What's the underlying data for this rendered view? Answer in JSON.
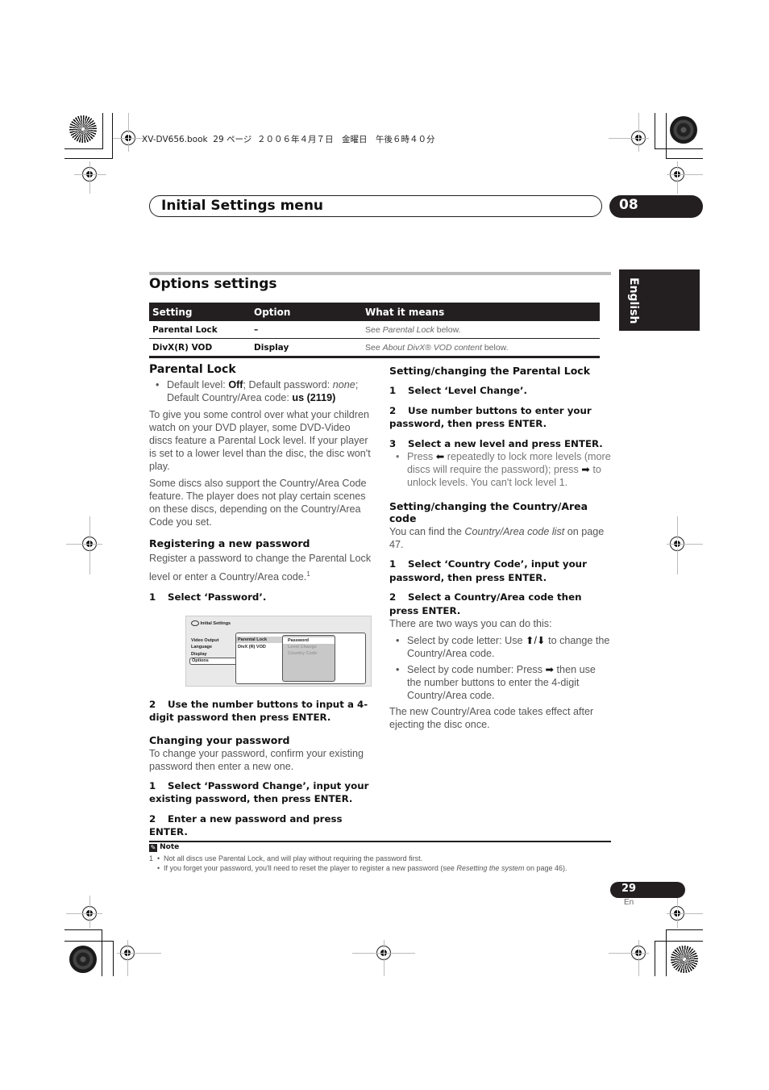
{
  "print_header": "XV-DV656.book  29 ページ  ２００６年４月７日　金曜日　午後６時４０分",
  "chapter": {
    "title": "Initial Settings menu",
    "number": "08"
  },
  "language_tab": "English",
  "section_title": "Options settings",
  "table": {
    "headers": [
      "Setting",
      "Option",
      "What it means"
    ],
    "rows": [
      {
        "setting": "Parental Lock",
        "option": "–",
        "meaning_prefix": "See ",
        "meaning_italic": "Parental Lock",
        "meaning_suffix": " below."
      },
      {
        "setting": "DivX(R) VOD",
        "option": "Display",
        "meaning_prefix": "See ",
        "meaning_italic": "About DivX® VOD content",
        "meaning_suffix": " below."
      }
    ]
  },
  "left": {
    "parental_lock": {
      "title": "Parental Lock",
      "defaults": {
        "level_label": "Default level: ",
        "level_value": "Off",
        "password_label": "; Default password: ",
        "password_value": "none",
        "country_label": "; Default Country/Area code: ",
        "country_value": "us (2119)"
      },
      "para1": "To give you some control over what your children watch on your DVD player, some DVD-Video discs feature a Parental Lock level. If your player is set to a lower level than the disc, the disc won't play.",
      "para2": "Some discs also support the Country/Area Code feature. The player does not play certain scenes on these discs, depending on the Country/Area Code you set."
    },
    "register": {
      "title": "Registering a new password",
      "text": "Register a password to change the Parental Lock level or enter a Country/Area code.",
      "footnote_ref": "1",
      "step1_num": "1",
      "step1": "Select ‘Password’.",
      "step2_num": "2",
      "step2": "Use the number buttons to input a 4-digit password then press ENTER."
    },
    "osd": {
      "title": "Initial Settings",
      "menu": [
        "Video Output",
        "Language",
        "Display",
        "Options"
      ],
      "submenu": [
        "Parental Lock",
        "DivX (R) VOD"
      ],
      "options": [
        "Password",
        "Level Change",
        "Country Code"
      ]
    },
    "change": {
      "title": "Changing your password",
      "text": "To change your password, confirm your existing password then enter a new one.",
      "step1_num": "1",
      "step1": "Select ‘Password Change’, input your existing password, then press ENTER.",
      "step2_num": "2",
      "step2": "Enter a new password and press ENTER."
    }
  },
  "right": {
    "parental": {
      "title": "Setting/changing the Parental Lock",
      "step1_num": "1",
      "step1": "Select ‘Level Change’.",
      "step2_num": "2",
      "step2": "Use number buttons to enter your password, then press ENTER.",
      "step3_num": "3",
      "step3": "Select a new level and press ENTER.",
      "bullet_a": "Press ",
      "bullet_left_arrow": "⬅",
      "bullet_b": " repeatedly to lock more levels (more discs will require the password); press ",
      "bullet_right_arrow": "➡",
      "bullet_c": " to unlock levels. You can't lock level 1."
    },
    "country": {
      "title": "Setting/changing the Country/Area code",
      "intro_a": "You can find the ",
      "intro_italic": "Country/Area code list",
      "intro_b": " on page 47.",
      "step1_num": "1",
      "step1": "Select ‘Country Code’, input your password, then press ENTER.",
      "step2_num": "2",
      "step2": "Select a Country/Area code then press ENTER.",
      "ways": "There are two ways you can do this:",
      "bullet1_a": "Select by code letter: Use ",
      "bullet1_arrows": "⬆/⬇",
      "bullet1_b": " to change the Country/Area code.",
      "bullet2_a": "Select by code number: Press ",
      "bullet2_arrow": "➡",
      "bullet2_b": " then use the number buttons to enter the 4-digit Country/Area code.",
      "closing": "The new Country/Area code takes effect after ejecting the disc once."
    }
  },
  "note": {
    "label": "Note",
    "num": "1",
    "item1": "Not all discs use Parental Lock, and will play without requiring the password first.",
    "item2_a": "If you forget your password, you'll need to reset the player to register a new password (see ",
    "item2_italic": "Resetting the system",
    "item2_b": " on page 46)."
  },
  "page": {
    "number": "29",
    "lang": "En"
  }
}
